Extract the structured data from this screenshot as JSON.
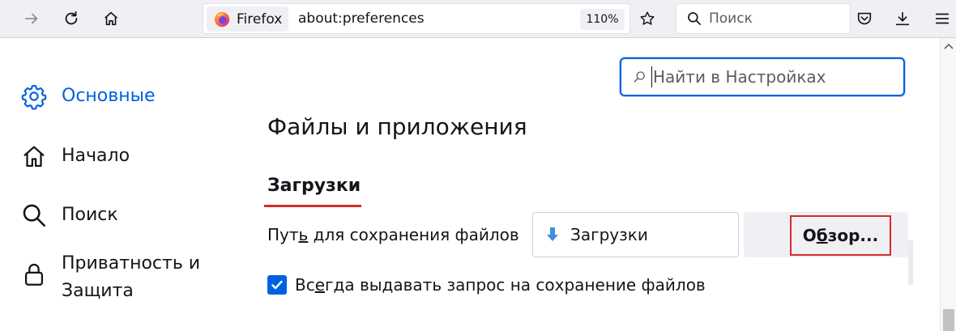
{
  "toolbar": {
    "identity_label": "Firefox",
    "url": "about:preferences",
    "zoom": "110%",
    "search_placeholder": "Поиск",
    "icons": [
      "forward-icon",
      "reload-icon",
      "home-icon",
      "firefox-logo-icon",
      "bookmark-star-icon",
      "search-icon",
      "pocket-icon",
      "download-icon",
      "menu-icon"
    ]
  },
  "sidebar": {
    "items": [
      {
        "label": "Основные",
        "icon": "gear-icon",
        "selected": true
      },
      {
        "label": "Начало",
        "icon": "home-icon",
        "selected": false
      },
      {
        "label": "Поиск",
        "icon": "search-icon",
        "selected": false
      },
      {
        "label": "Приватность и Защита",
        "icon": "lock-icon",
        "selected": false
      }
    ]
  },
  "find": {
    "placeholder": "Найти в Настройках"
  },
  "main": {
    "section_title": "Файлы и приложения",
    "subsection_title": "Загрузки",
    "path_label_prefix": "Пут",
    "path_label_underlined": "ь",
    "path_label_suffix": " для сохранения файлов",
    "download_folder": "Загрузки",
    "browse_label_prefix": "О",
    "browse_label_underlined": "б",
    "browse_label_suffix": "зор...",
    "ask_checkbox_checked": true,
    "ask_label_prefix": "Вс",
    "ask_label_underlined": "е",
    "ask_label_suffix": "гда выдавать запрос на сохранение файлов"
  },
  "colors": {
    "accent": "#0061e0",
    "highlight": "#d52b2b",
    "toolbar_bg": "#f0f0f4"
  }
}
